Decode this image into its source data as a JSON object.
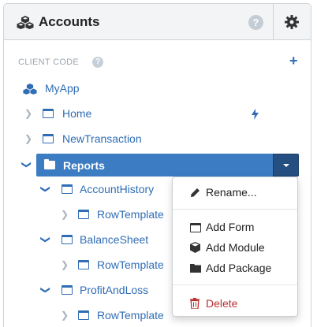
{
  "header": {
    "title": "Accounts",
    "help_glyph": "?",
    "icons": [
      "cubes-icon",
      "help-icon",
      "gear-icon"
    ]
  },
  "section": {
    "label": "CLIENT CODE",
    "help_glyph": "?",
    "add_glyph": "+"
  },
  "tree": {
    "root": {
      "label": "MyApp",
      "icon": "cubes-icon"
    },
    "items": [
      {
        "label": "Home",
        "icon": "window-icon",
        "badge": "bolt-icon",
        "expanded": false
      },
      {
        "label": "NewTransaction",
        "icon": "window-icon",
        "expanded": false
      },
      {
        "label": "Reports",
        "icon": "folder-icon",
        "expanded": true,
        "selected": true
      },
      {
        "label": "AccountHistory",
        "icon": "window-icon",
        "expanded": true
      },
      {
        "label": "RowTemplate",
        "icon": "window-icon",
        "expanded": false
      },
      {
        "label": "BalanceSheet",
        "icon": "window-icon",
        "expanded": true
      },
      {
        "label": "RowTemplate",
        "icon": "window-icon",
        "expanded": false
      },
      {
        "label": "ProfitAndLoss",
        "icon": "window-icon",
        "expanded": true
      },
      {
        "label": "RowTemplate",
        "icon": "window-icon",
        "expanded": false
      }
    ]
  },
  "context_menu": {
    "items": [
      {
        "label": "Rename...",
        "icon": "pencil-icon"
      },
      {
        "label": "Add Form",
        "icon": "window-icon"
      },
      {
        "label": "Add Module",
        "icon": "cube-icon"
      },
      {
        "label": "Add Package",
        "icon": "folder-icon"
      },
      {
        "label": "Delete",
        "icon": "trash-icon"
      }
    ]
  },
  "colors": {
    "accent": "#2f6db5",
    "selected_bg": "#3b7cc2",
    "danger": "#b73232"
  }
}
